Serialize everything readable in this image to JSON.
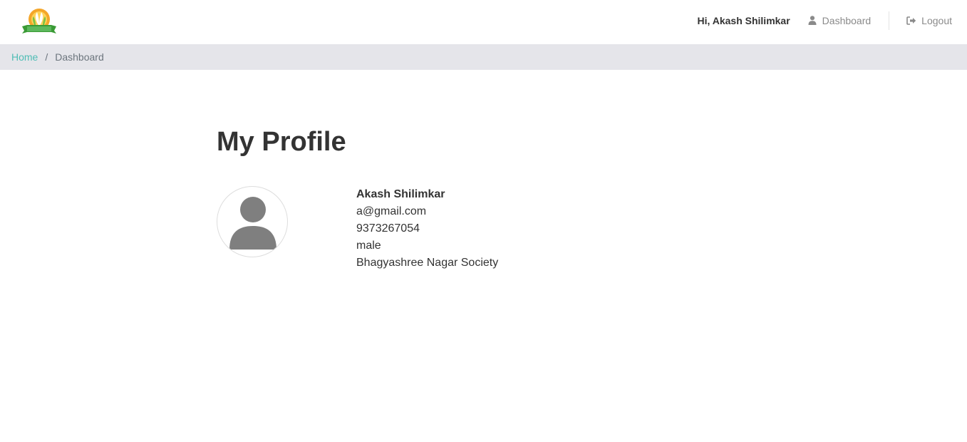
{
  "header": {
    "greeting": "Hi, Akash Shilimkar",
    "nav": {
      "dashboard_label": "Dashboard",
      "logout_label": "Logout"
    }
  },
  "breadcrumb": {
    "home": "Home",
    "separator": "/",
    "current": "Dashboard"
  },
  "profile": {
    "title": "My Profile",
    "name": "Akash Shilimkar",
    "email": "a@gmail.com",
    "phone": "9373267054",
    "gender": "male",
    "address": "Bhagyashree Nagar Society"
  },
  "icons": {
    "logo": "leaf-logo-icon",
    "dashboard": "user-icon",
    "logout": "sign-out-icon",
    "avatar": "user-silhouette-icon"
  },
  "colors": {
    "link_accent": "#4fbdb5",
    "breadcrumb_bg": "#e5e5ea",
    "muted_text": "#8a8a8a",
    "text": "#333333"
  }
}
